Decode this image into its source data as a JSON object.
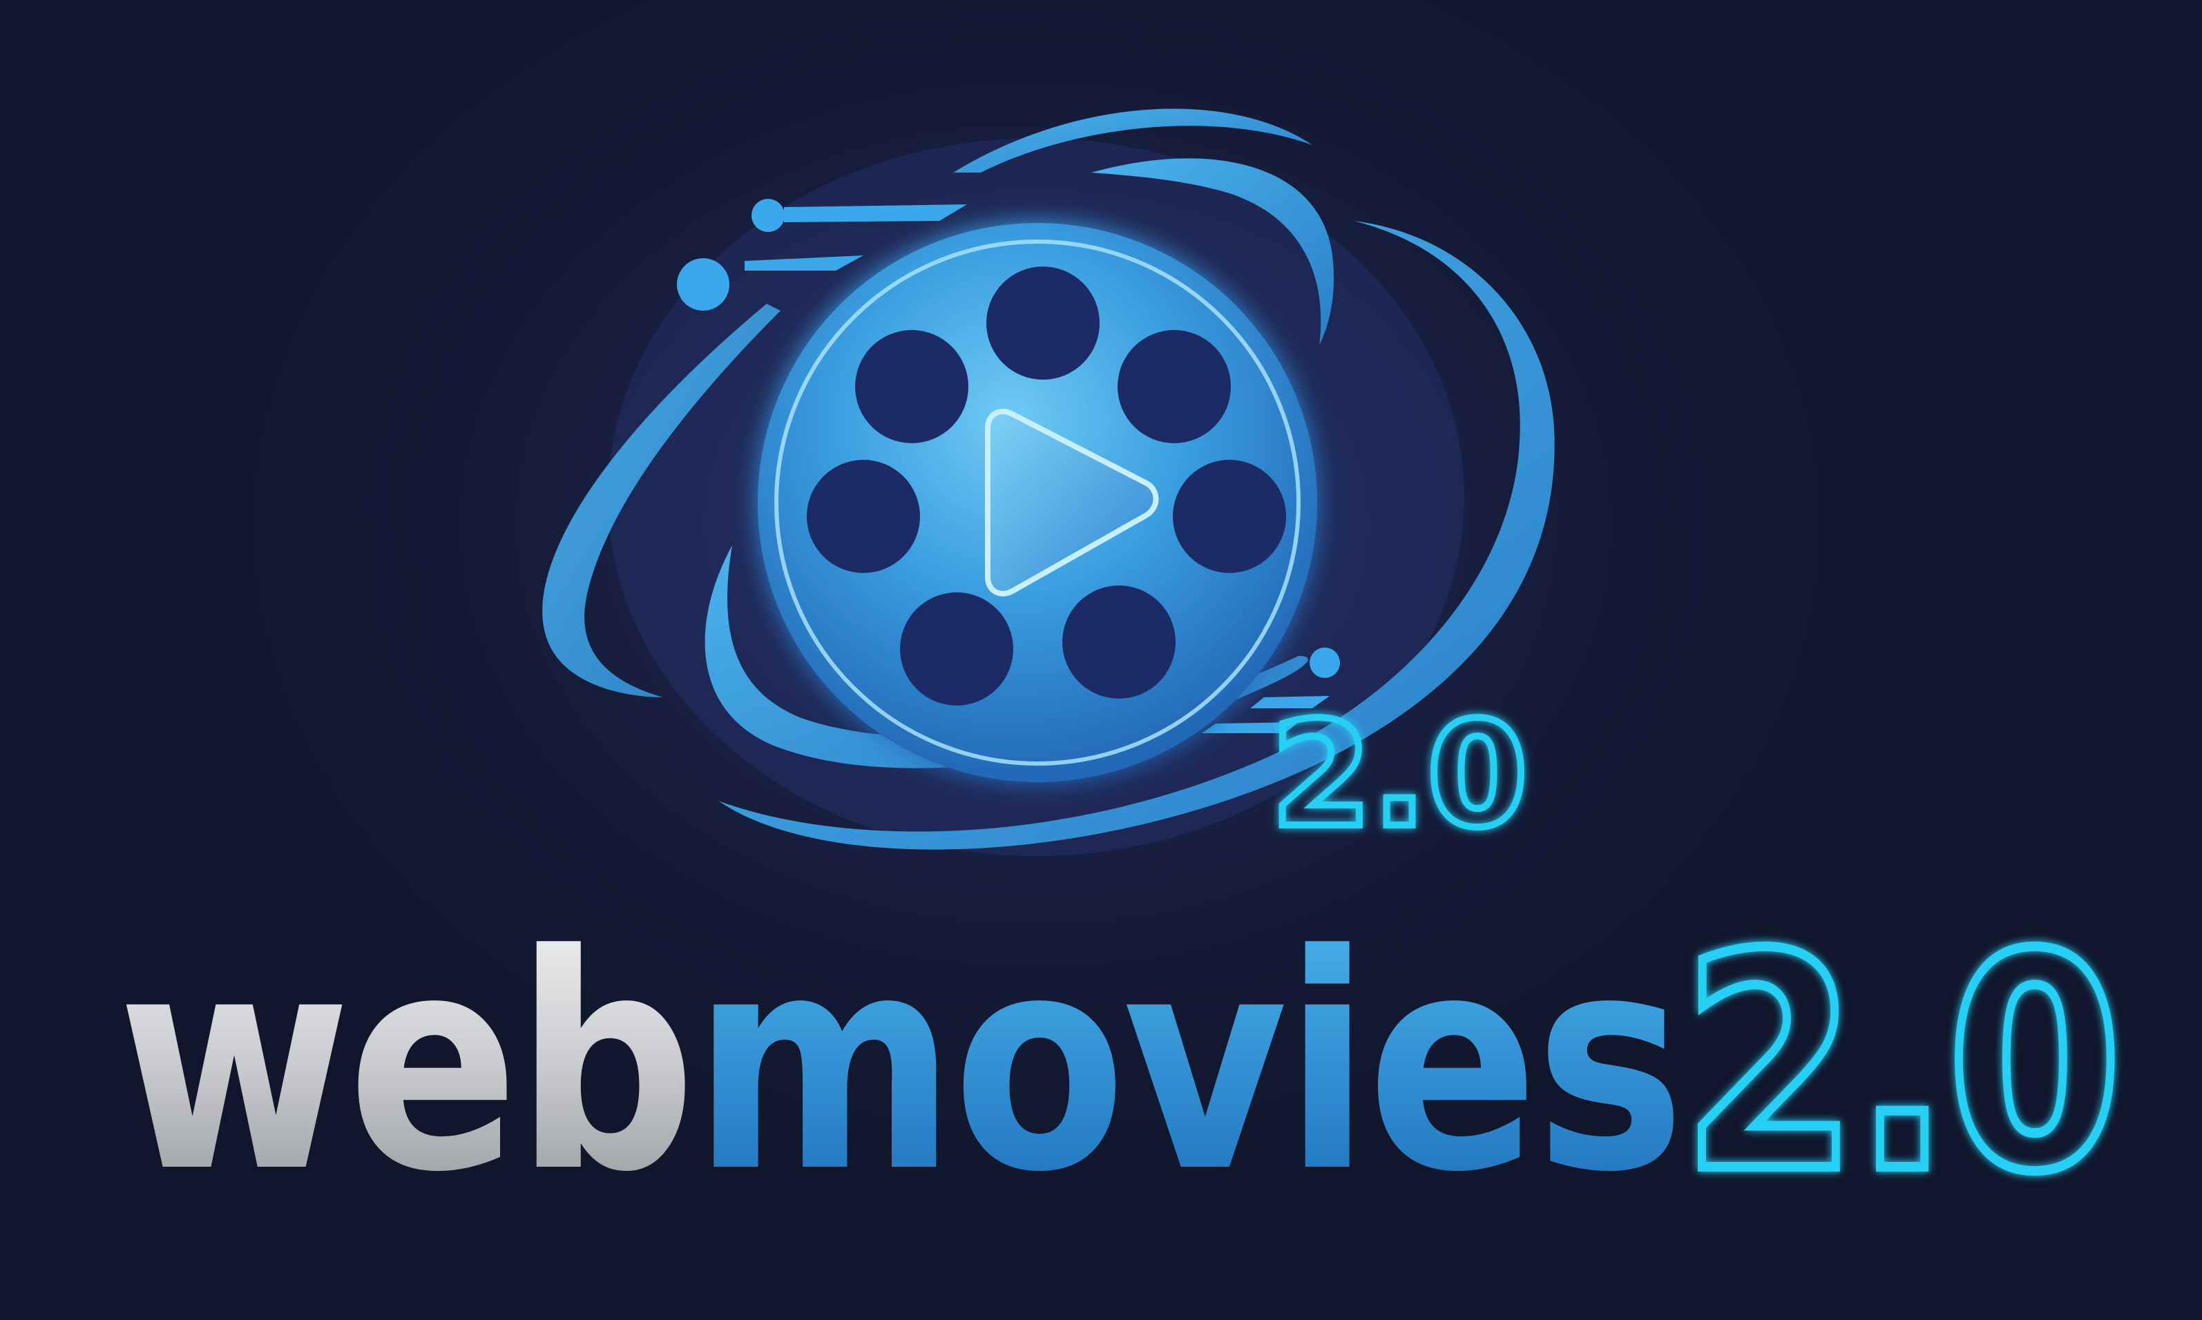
{
  "logo": {
    "icon_name": "film-reel-play-icon",
    "icon_badge": "2.0",
    "wordmark": {
      "part1": "web",
      "part2": "movies",
      "part3": "2.0"
    },
    "colors": {
      "background": "#151a33",
      "reel_blue": "#3a9fe0",
      "orbit_blue": "#2f8fd6",
      "neon_cyan": "#28d0f5",
      "silver": "#d9dbde"
    }
  }
}
